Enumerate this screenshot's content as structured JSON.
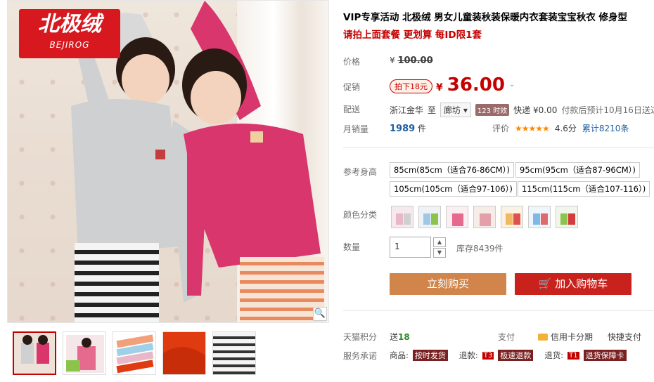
{
  "product": {
    "title": "VIP专享活动 北极绒 男女儿童装秋装保暖内衣套装宝宝秋衣 修身型",
    "subtitle": "请拍上面套餐 更划算 每ID限1套",
    "brand_cn": "北极绒",
    "brand_en": "BEJIROG"
  },
  "labels": {
    "price": "价格",
    "promo": "促销",
    "ship": "配送",
    "monthly_sales": "月销量",
    "size": "参考身高",
    "color": "颜色分类",
    "quantity": "数量",
    "tmall_points": "天猫积分",
    "service": "服务承诺"
  },
  "price": {
    "currency": "¥",
    "original": "100.00",
    "promo_badge": "拍下18元",
    "current": "36.00"
  },
  "shipping": {
    "from": "浙江金华",
    "to_word": "至",
    "to": "廊坊",
    "dd_arrow": "▾",
    "tag": "123 时效",
    "express": "快递 ¥0.00",
    "note": "付款后预计10月16日送达"
  },
  "sales": {
    "count": "1989",
    "unit": "件",
    "rating_label": "评价",
    "stars": "★★★★★",
    "score": "4.6分",
    "total": "累计8210条"
  },
  "sizes": [
    "85cm(85cm（适合76-86CM）)",
    "95cm(95cm（适合87-96CM）)",
    "105cm(105cm（适合97-106）)",
    "115cm(115cm（适合107-116）)"
  ],
  "colors": [
    "#e9b7c5",
    "#d8e2ea",
    "#e7a5c4",
    "#e4c2c6",
    "#f0d39b",
    "#cfe3f2",
    "#d6e6c8"
  ],
  "quantity": {
    "value": "1",
    "up": "▲",
    "down": "▼",
    "stock": "库存8439件"
  },
  "buttons": {
    "buy": "立刻购买",
    "cart_icon": "🛒",
    "cart": "加入购物车"
  },
  "points": {
    "prefix": "送",
    "value": "18"
  },
  "payment": {
    "label": "支付",
    "credit": "信用卡分期",
    "quick": "快捷支付"
  },
  "service": {
    "goods_label": "商品:",
    "goods_tag": "按时发货",
    "refund_label": "退款:",
    "refund_t3": "T3",
    "refund_tag": "极速退款",
    "return_label": "退货:",
    "return_t1": "T1",
    "return_tag": "退货保障卡"
  },
  "icons": {
    "zoom": "🔍",
    "chevron": "⌄"
  },
  "thumbnail_colors": [
    "#d9b0bd",
    "#e56a8e",
    "#f2a07a",
    "#e03a10",
    "#b9b9c8"
  ]
}
